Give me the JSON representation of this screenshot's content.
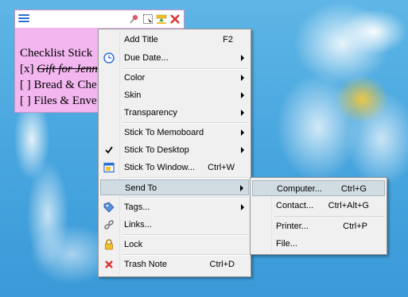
{
  "note": {
    "body_lines": [
      {
        "prefix": "",
        "text": "Checklist Stick"
      },
      {
        "prefix": "[x] ",
        "text": "Gift for Jenn"
      },
      {
        "prefix": "[ ] ",
        "text": "Bread & Che"
      },
      {
        "prefix": "[ ] ",
        "text": "Files & Enve"
      }
    ],
    "toolbar_icons": [
      "pin-icon",
      "select-icon",
      "layer-icon",
      "close-icon"
    ]
  },
  "menu": {
    "items": [
      {
        "label": "Add Title",
        "shortcut": "F2"
      },
      {
        "label": "Due Date...",
        "shortcut": ""
      },
      {
        "label": "Color",
        "shortcut": ""
      },
      {
        "label": "Skin",
        "shortcut": ""
      },
      {
        "label": "Transparency",
        "shortcut": ""
      },
      {
        "label": "Stick To Memoboard",
        "shortcut": ""
      },
      {
        "label": "Stick To Desktop",
        "shortcut": ""
      },
      {
        "label": "Stick To Window...",
        "shortcut": "Ctrl+W"
      },
      {
        "label": "Send To",
        "shortcut": ""
      },
      {
        "label": "Tags...",
        "shortcut": ""
      },
      {
        "label": "Links...",
        "shortcut": ""
      },
      {
        "label": "Lock",
        "shortcut": ""
      },
      {
        "label": "Trash Note",
        "shortcut": "Ctrl+D"
      }
    ]
  },
  "submenu": {
    "items": [
      {
        "label": "Computer...",
        "shortcut": "Ctrl+G"
      },
      {
        "label": "Contact...",
        "shortcut": "Ctrl+Alt+G"
      },
      {
        "label": "Printer...",
        "shortcut": "Ctrl+P"
      },
      {
        "label": "File...",
        "shortcut": ""
      }
    ]
  },
  "colors": {
    "note_bg": "#f3b6ef",
    "menu_bg": "#f0f0f0",
    "highlight": "#d1dbe2"
  }
}
